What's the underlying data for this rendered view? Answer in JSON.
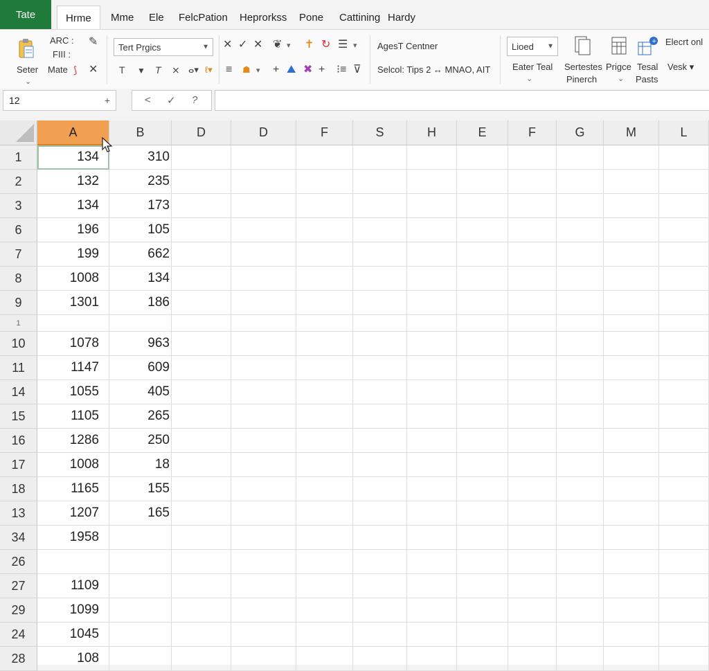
{
  "tabs": {
    "file": "Tate",
    "items": [
      "Hrme",
      "Mme",
      "Ele",
      "FelcPation",
      "Heprorkss",
      "Pone",
      "Cattining",
      "Hardy"
    ],
    "active_index": 0
  },
  "ribbon": {
    "clipboard": {
      "line1": "ARC :",
      "line2": "FIII :",
      "paste_label": "Seter",
      "format_label": "Mate"
    },
    "font_box": {
      "value": "Tert Prgics"
    },
    "font_row2": [
      "T",
      "▼",
      "T",
      "⨯",
      "ⴰ▾",
      "ℓ▾"
    ],
    "align": {
      "center_label": "AgesT Centner",
      "wrap_label": "Selcol: Tips 2 ↔ MNAO, AIT"
    },
    "number_box": {
      "value": "Lioed"
    },
    "styles": {
      "enter_label": "Eater Teal",
      "sort_label_1": "Sertestes",
      "sort_label_2": "Pinerch",
      "find_label": "Prigce",
      "total_label_1": "Tesal",
      "total_label_2": "Pasts"
    },
    "effect": {
      "top_label": "Elecrt onl",
      "vesk_label": "Vesk"
    }
  },
  "formula_bar": {
    "name_box": "12",
    "plus": "+",
    "cancel": "<",
    "enter": "✓",
    "fx": "?",
    "content": ""
  },
  "grid": {
    "columns": [
      "A",
      "B",
      "D",
      "D",
      "F",
      "S",
      "H",
      "E",
      "F",
      "G",
      "M",
      "L"
    ],
    "selected_column": "A",
    "rows": [
      {
        "head": "1",
        "a": "134",
        "b": "310"
      },
      {
        "head": "2",
        "a": "132",
        "b": "235"
      },
      {
        "head": "3",
        "a": "134",
        "b": "173"
      },
      {
        "head": "6",
        "a": "196",
        "b": "105"
      },
      {
        "head": "7",
        "a": "199",
        "b": "662"
      },
      {
        "head": "8",
        "a": "1008",
        "b": "134"
      },
      {
        "head": "9",
        "a": "1301",
        "b": "186"
      },
      {
        "head": "1",
        "a": "",
        "b": ""
      },
      {
        "head": "10",
        "a": "1078",
        "b": "963"
      },
      {
        "head": "11",
        "a": "1147",
        "b": "609"
      },
      {
        "head": "14",
        "a": "1055",
        "b": "405"
      },
      {
        "head": "15",
        "a": "1105",
        "b": "265"
      },
      {
        "head": "16",
        "a": "1286",
        "b": "250"
      },
      {
        "head": "17",
        "a": "1008",
        "b": "18"
      },
      {
        "head": "18",
        "a": "1165",
        "b": "155"
      },
      {
        "head": "13",
        "a": "1207",
        "b": "165"
      },
      {
        "head": "34",
        "a": "1958",
        "b": ""
      },
      {
        "head": "26",
        "a": "",
        "b": ""
      },
      {
        "head": "27",
        "a": "1109",
        "b": ""
      },
      {
        "head": "29",
        "a": "1099",
        "b": ""
      },
      {
        "head": "24",
        "a": "1045",
        "b": ""
      },
      {
        "head": "28",
        "a": "108",
        "b": ""
      }
    ]
  },
  "colors": {
    "file_tab": "#1e7b3a",
    "selected_header": "#f0a050",
    "active_cell_border": "#9cc3a6"
  }
}
